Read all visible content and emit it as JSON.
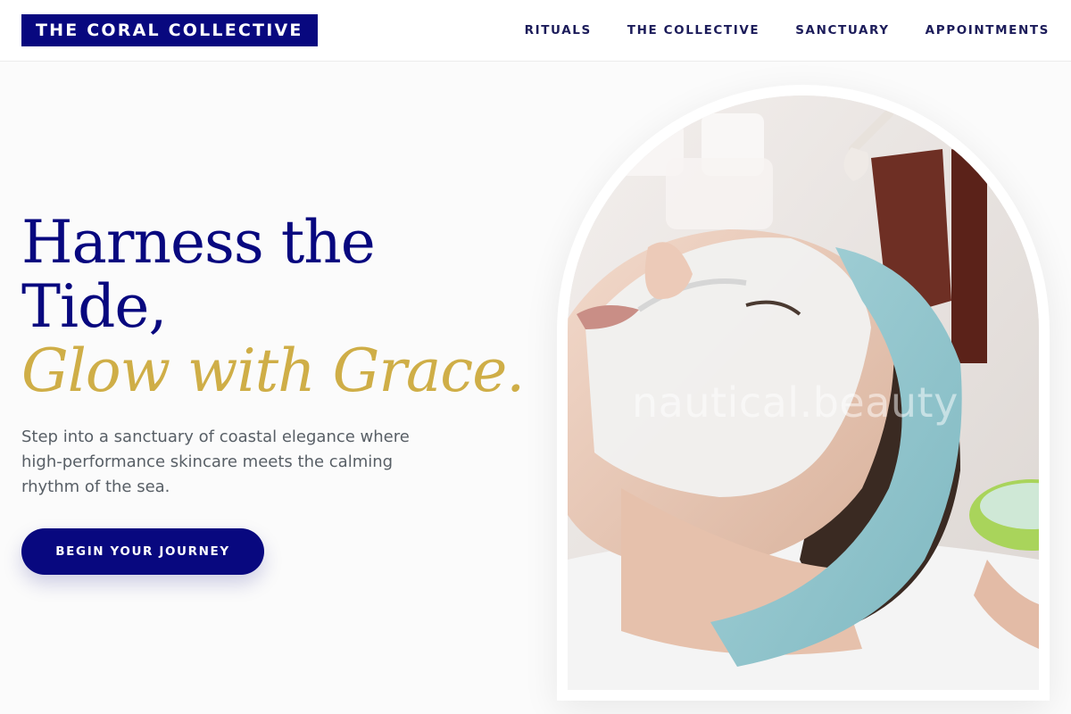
{
  "header": {
    "logo": "THE CORAL COLLECTIVE",
    "nav": [
      "RITUALS",
      "THE COLLECTIVE",
      "SANCTUARY",
      "APPOINTMENTS"
    ]
  },
  "hero": {
    "headline_line1": "Harness the",
    "headline_line2": "Tide,",
    "headline_accent": "Glow with Grace.",
    "subtext": "Step into a sanctuary of coastal elegance where high-performance skincare meets the calming rhythm of the sea.",
    "cta_label": "BEGIN YOUR JOURNEY",
    "image_alt": "Woman receiving a facial mask treatment",
    "watermark": "nautical.beauty"
  },
  "colors": {
    "navy": "#08087f",
    "gold": "#cfae47",
    "body_text": "#585f66",
    "background": "#fbfbfb"
  }
}
